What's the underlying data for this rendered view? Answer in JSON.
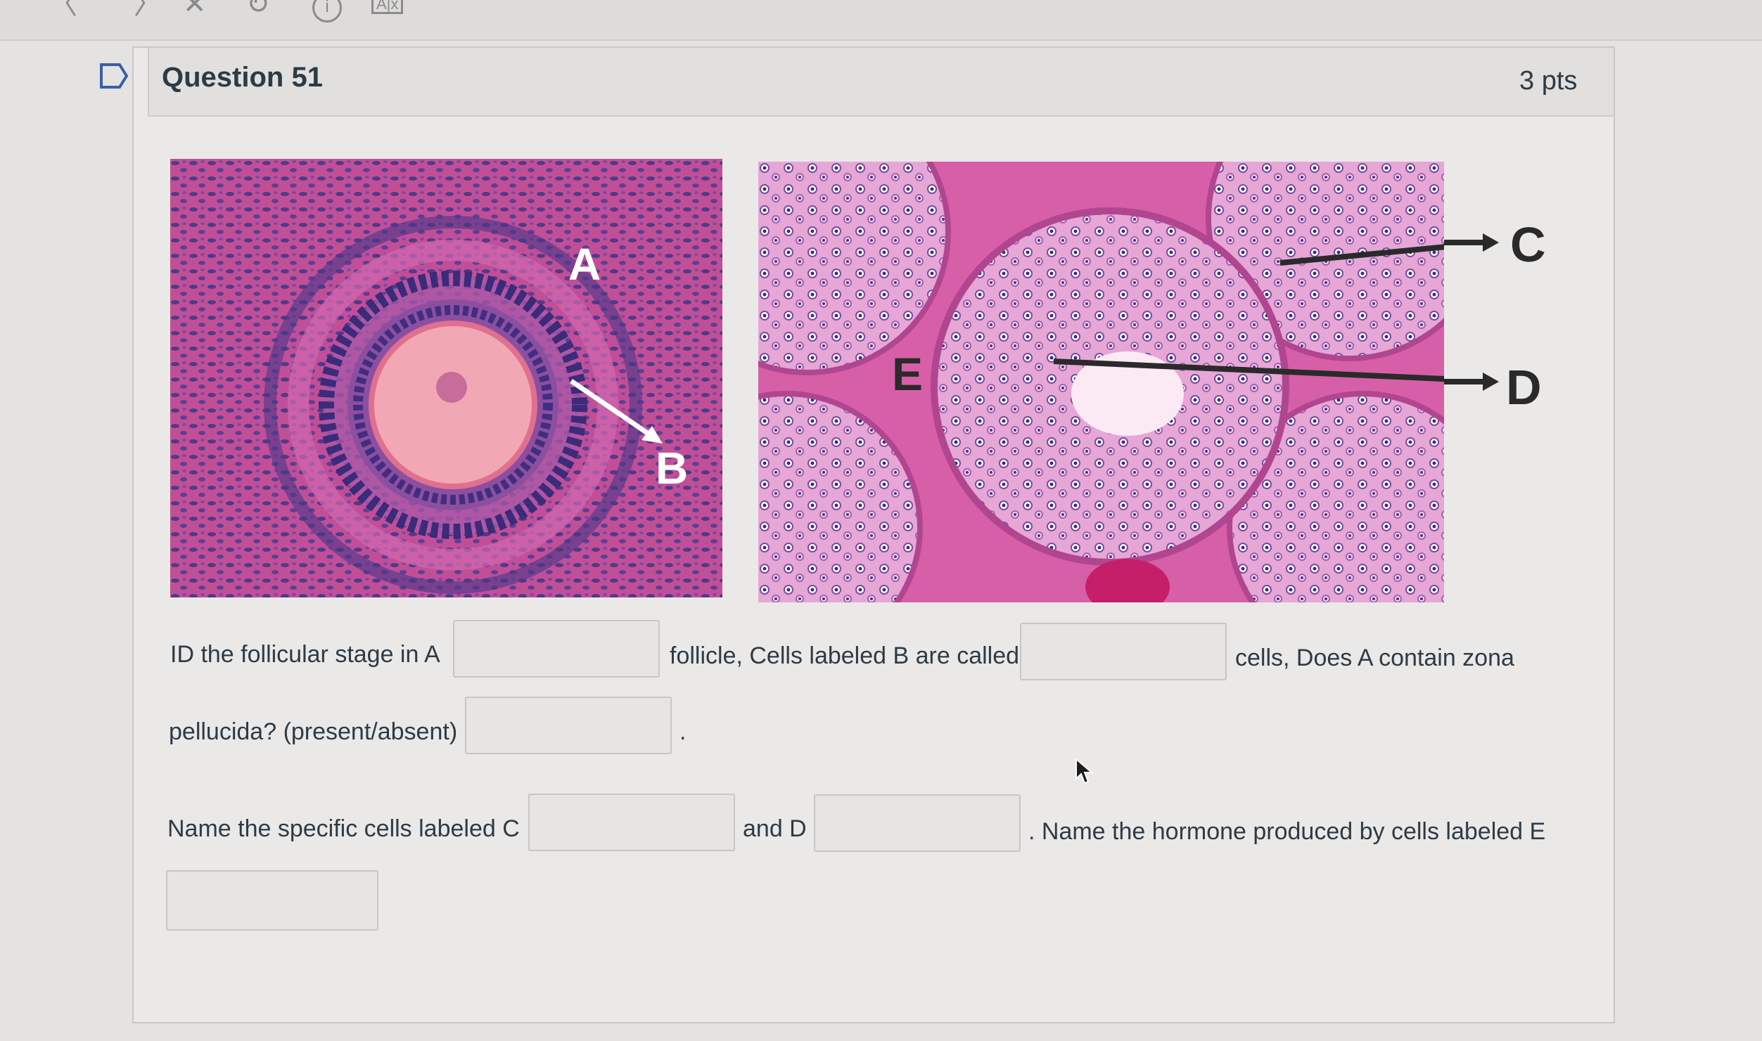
{
  "question": {
    "title": "Question 51",
    "points": "3 pts"
  },
  "images": {
    "ovary": {
      "labels": {
        "a": "A",
        "b": "B"
      }
    },
    "testis": {
      "labels": {
        "c": "C",
        "d": "D",
        "e": "E"
      }
    }
  },
  "prompt": {
    "line1_part1": "ID the follicular stage in A",
    "line1_part2": "follicle, Cells labeled B are called",
    "line1_part3": "cells,  Does A contain zona",
    "line2_part1": "pellucida? (present/absent)",
    "line2_part2": ".",
    "line3_part1": "Name the specific cells labeled C",
    "line3_part2": "and D",
    "line3_part3": ". Name the hormone produced by cells labeled E"
  },
  "answers": {
    "follicular_stage": "",
    "cells_b": "",
    "zona_pellucida": "",
    "cells_c": "",
    "cells_d": "",
    "hormone_e": ""
  },
  "icons": [
    "back-icon",
    "forward-icon",
    "close-icon",
    "refresh-icon",
    "info-icon",
    "accessibility-icon",
    "flag-icon",
    "mouse-cursor-icon"
  ],
  "colors": {
    "tissue_pink": "#d65fa8",
    "nuclei_purple": "#5a3f8e",
    "oocyte": "#f2a7b5"
  }
}
